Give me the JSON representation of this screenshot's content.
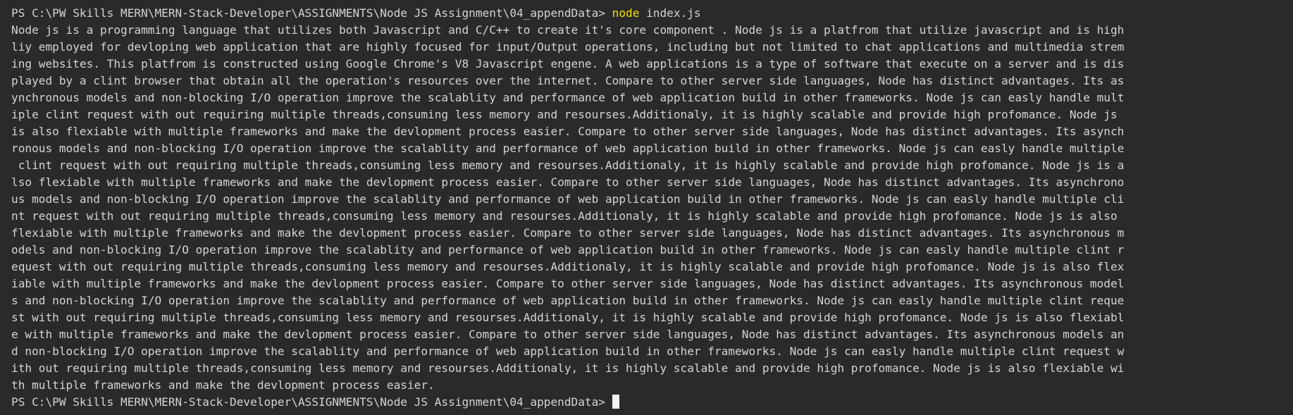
{
  "terminal": {
    "prompt": "PS C:\\PW Skills MERN\\MERN-Stack-Developer\\ASSIGNMENTS\\Node JS Assignment\\04_appendData> ",
    "command": "node",
    "args": " index.js",
    "output_lines": [
      "Node js is a programming language that utilizes both Javascript and C/C++ to create it's core component . Node js is a platfrom that utilize javascript and is high",
      "liy employed for devloping web application that are highly focused for input/Output operations, including but not limited to chat applications and multimedia strem",
      "ing websites. This platfrom is constructed using Google Chrome's V8 Javascript engene. A web applications is a type of software that execute on a server and is dis",
      "played by a clint browser that obtain all the operation's resources over the internet. Compare to other server side languages, Node has distinct advantages. Its as",
      "ynchronous models and non-blocking I/O operation improve the scalablity and performance of web application build in other frameworks. Node js can easly handle mult",
      "iple clint request with out requiring multiple threads,consuming less memory and resourses.Additionaly, it is highly scalable and provide high profomance. Node js",
      "is also flexiable with multiple frameworks and make the devlopment process easier. Compare to other server side languages, Node has distinct advantages. Its asynch",
      "ronous models and non-blocking I/O operation improve the scalablity and performance of web application build in other frameworks. Node js can easly handle multiple",
      " clint request with out requiring multiple threads,consuming less memory and resourses.Additionaly, it is highly scalable and provide high profomance. Node js is a",
      "lso flexiable with multiple frameworks and make the devlopment process easier. Compare to other server side languages, Node has distinct advantages. Its asynchrono",
      "us models and non-blocking I/O operation improve the scalablity and performance of web application build in other frameworks. Node js can easly handle multiple cli",
      "nt request with out requiring multiple threads,consuming less memory and resourses.Additionaly, it is highly scalable and provide high profomance. Node js is also",
      "flexiable with multiple frameworks and make the devlopment process easier. Compare to other server side languages, Node has distinct advantages. Its asynchronous m",
      "odels and non-blocking I/O operation improve the scalablity and performance of web application build in other frameworks. Node js can easly handle multiple clint r",
      "equest with out requiring multiple threads,consuming less memory and resourses.Additionaly, it is highly scalable and provide high profomance. Node js is also flex",
      "iable with multiple frameworks and make the devlopment process easier. Compare to other server side languages, Node has distinct advantages. Its asynchronous model",
      "s and non-blocking I/O operation improve the scalablity and performance of web application build in other frameworks. Node js can easly handle multiple clint reque",
      "st with out requiring multiple threads,consuming less memory and resourses.Additionaly, it is highly scalable and provide high profomance. Node js is also flexiabl",
      "e with multiple frameworks and make the devlopment process easier. Compare to other server side languages, Node has distinct advantages. Its asynchronous models an",
      "d non-blocking I/O operation improve the scalablity and performance of web application build in other frameworks. Node js can easly handle multiple clint request w",
      "ith out requiring multiple threads,consuming less memory and resourses.Additionaly, it is highly scalable and provide high profomance. Node js is also flexiable wi",
      "th multiple frameworks and make the devlopment process easier."
    ],
    "final_prompt": "PS C:\\PW Skills MERN\\MERN-Stack-Developer\\ASSIGNMENTS\\Node JS Assignment\\04_appendData> "
  },
  "colors": {
    "background": "#2a2a2a",
    "text": "#d4d4d4",
    "command": "#f0e000",
    "cursor": "#f2f2f2"
  }
}
